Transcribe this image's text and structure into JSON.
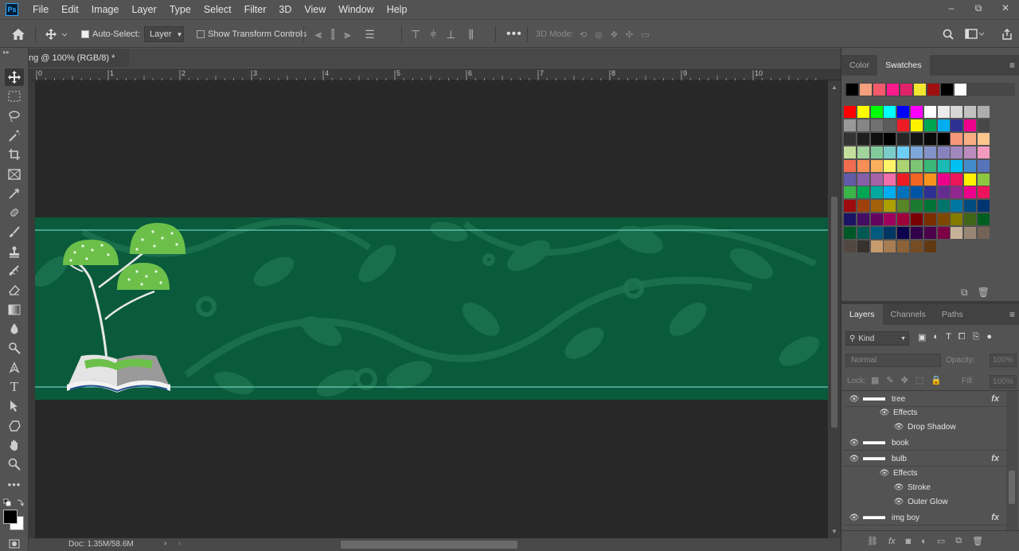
{
  "menu": [
    "File",
    "Edit",
    "Image",
    "Layer",
    "Type",
    "Select",
    "Filter",
    "3D",
    "View",
    "Window",
    "Help"
  ],
  "app_logo": "Ps",
  "window_controls": [
    "–",
    "⧉",
    "✕"
  ],
  "options": {
    "auto_select_label": "Auto-Select:",
    "auto_select_value": "Layer",
    "transform_label": "Show Transform Controls",
    "mode_3d_label": "3D Mode:"
  },
  "document": {
    "tab_title": "ng @ 100% (RGB/8) *",
    "status": "Doc: 1.35M/58.6M",
    "ruler_ticks": [
      "0",
      "1",
      "2",
      "3",
      "4",
      "5",
      "6",
      "7",
      "8",
      "9",
      "10"
    ]
  },
  "color_panel": {
    "tabs": [
      "Color",
      "Swatches"
    ],
    "active_tab": "Swatches",
    "recent": [
      "#000000",
      "#f4a07c",
      "#f45a6a",
      "#ff1a8c",
      "#e0226b",
      "#f2e630",
      "#a01010",
      "#000000",
      "#ffffff"
    ],
    "grid": [
      [
        "#ff0000",
        "#ffff00",
        "#00ff00",
        "#00ffff",
        "#0000ff",
        "#ff00ff",
        "#ffffff",
        "#ebebeb",
        "#d6d6d6",
        "#c2c2c2",
        "#adadad"
      ],
      [
        "#999999",
        "#858585",
        "#707070",
        "#5c5c5c",
        "#ed1c24",
        "#fff200",
        "#00a651",
        "#00aeef",
        "#2e3192",
        "#ec008c",
        "#474747"
      ],
      [
        "#333333",
        "#1f1f1f",
        "#0f0f0f",
        "#000000",
        "#262626",
        "#141414",
        "#0a0a0a",
        "#000000",
        "#f7977a",
        "#fbad82",
        "#fdc68c"
      ],
      [
        "#c4df9b",
        "#a2d39c",
        "#82ca9c",
        "#7accc8",
        "#6dcff6",
        "#7da7d9",
        "#8393ca",
        "#8882be",
        "#a187be",
        "#bc8cbf",
        "#f49ac1"
      ],
      [
        "#f26c4f",
        "#f68e56",
        "#fbaf5c",
        "#fff467",
        "#acd372",
        "#7cc576",
        "#3bb878",
        "#1abbb4",
        "#00bff3",
        "#438ccb",
        "#5574b9"
      ],
      [
        "#605ca8",
        "#855fa8",
        "#a763a8",
        "#f06eaa",
        "#ed1c24",
        "#f26522",
        "#f7941d",
        "#ec008c",
        "#ed145b",
        "#fff200",
        "#8dc63f"
      ],
      [
        "#39b54a",
        "#00a651",
        "#00a99d",
        "#00aeef",
        "#0072bc",
        "#0054a6",
        "#2e3192",
        "#662d91",
        "#92278f",
        "#ec008c",
        "#ed145b"
      ],
      [
        "#9e0b0f",
        "#a0410d",
        "#a36209",
        "#aba000",
        "#598527",
        "#1a7b30",
        "#007236",
        "#00746b",
        "#0076a3",
        "#004b80",
        "#003471"
      ],
      [
        "#1b1464",
        "#440e62",
        "#630460",
        "#9e005d",
        "#9e0039",
        "#790000",
        "#7b2e00",
        "#7d4900",
        "#827b00",
        "#406618",
        "#005e20"
      ],
      [
        "#005826",
        "#005952",
        "#005b7f",
        "#003663",
        "#0d004c",
        "#32004b",
        "#4b0049",
        "#7b0046",
        "#c7b299",
        "#998675",
        "#736357"
      ],
      [
        "#534741",
        "#37302d",
        "#c69c6d",
        "#a67c52",
        "#8c6239",
        "#754c24",
        "#603913"
      ]
    ]
  },
  "layers_panel": {
    "tabs": [
      "Layers",
      "Channels",
      "Paths"
    ],
    "active_tab": "Layers",
    "filter_kind": "Kind",
    "blend_mode": "Normal",
    "opacity_label": "Opacity:",
    "opacity_value": "100%",
    "lock_label": "Lock:",
    "fill_label": "Fill:",
    "fill_value": "100%",
    "rows": [
      {
        "name": "tree",
        "type": "layer",
        "fx": "fx"
      },
      {
        "name": "Effects",
        "type": "effects"
      },
      {
        "name": "Drop Shadow",
        "type": "effect"
      },
      {
        "name": "book",
        "type": "layer",
        "fx": ""
      },
      {
        "name": "bulb",
        "type": "layer",
        "fx": "fx"
      },
      {
        "name": "Effects",
        "type": "effects"
      },
      {
        "name": "Stroke",
        "type": "effect"
      },
      {
        "name": "Outer Glow",
        "type": "effect"
      },
      {
        "name": "img boy",
        "type": "layer",
        "fx": "fx"
      }
    ]
  }
}
